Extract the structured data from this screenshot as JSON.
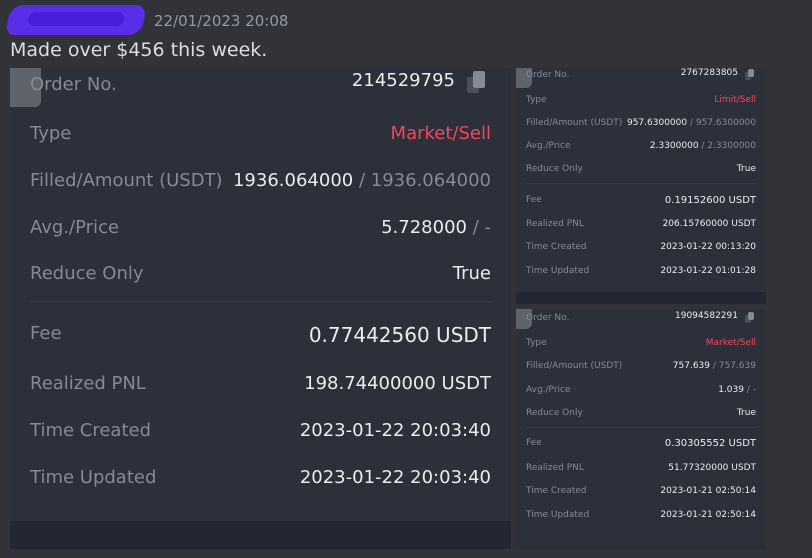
{
  "message": {
    "timestamp": "22/01/2023 20:08",
    "text": "Made over $456 this week."
  },
  "colors": {
    "background": "#313338",
    "card_background": "#2b303b",
    "sell_red": "#f6465d",
    "username_blur": "#5a2ee8"
  },
  "cards": [
    {
      "order_label": "Order No.",
      "order_no": "214529795",
      "type_label": "Type",
      "type_value": "Market/Sell",
      "filled_label": "Filled/Amount (USDT)",
      "filled_main": "1936.064000",
      "filled_sub": "/ 1936.064000",
      "avg_label": "Avg./Price",
      "avg_main": "5.728000",
      "avg_sub": "/ -",
      "reduce_label": "Reduce Only",
      "reduce_value": "True",
      "fee_label": "Fee",
      "fee_value": "0.77442560 USDT",
      "pnl_label": "Realized PNL",
      "pnl_value": "198.74400000 USDT",
      "created_label": "Time Created",
      "created_value": "2023-01-22 20:03:40",
      "updated_label": "Time Updated",
      "updated_value": "2023-01-22 20:03:40"
    },
    {
      "order_label": "Order No.",
      "order_no": "2767283805",
      "type_label": "Type",
      "type_value": "Limit/Sell",
      "filled_label": "Filled/Amount (USDT)",
      "filled_main": "957.6300000",
      "filled_sub": "/ 957.6300000",
      "avg_label": "Avg./Price",
      "avg_main": "2.3300000",
      "avg_sub": "/ 2.3300000",
      "reduce_label": "Reduce Only",
      "reduce_value": "True",
      "fee_label": "Fee",
      "fee_value": "0.19152600 USDT",
      "pnl_label": "Realized PNL",
      "pnl_value": "206.15760000 USDT",
      "created_label": "Time Created",
      "created_value": "2023-01-22 00:13:20",
      "updated_label": "Time Updated",
      "updated_value": "2023-01-22 01:01:28"
    },
    {
      "order_label": "Order No.",
      "order_no": "19094582291",
      "type_label": "Type",
      "type_value": "Market/Sell",
      "filled_label": "Filled/Amount (USDT)",
      "filled_main": "757.639",
      "filled_sub": "/ 757.639",
      "avg_label": "Avg./Price",
      "avg_main": "1.039",
      "avg_sub": "/ -",
      "reduce_label": "Reduce Only",
      "reduce_value": "True",
      "fee_label": "Fee",
      "fee_value": "0.30305552 USDT",
      "pnl_label": "Realized PNL",
      "pnl_value": "51.77320000 USDT",
      "created_label": "Time Created",
      "created_value": "2023-01-21 02:50:14",
      "updated_label": "Time Updated",
      "updated_value": "2023-01-21 02:50:14"
    }
  ]
}
